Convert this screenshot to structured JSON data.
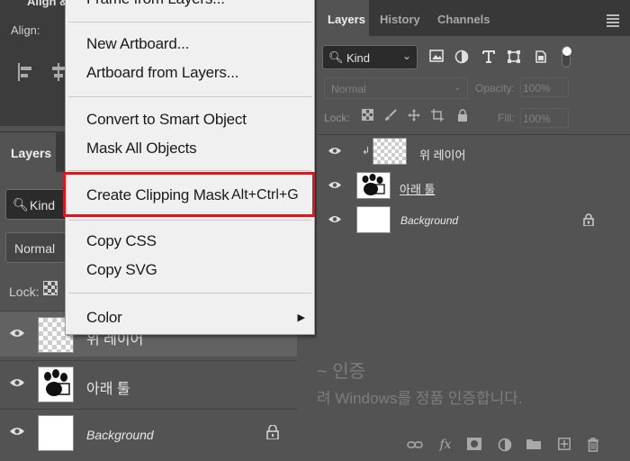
{
  "align_panel": {
    "title": "Align &",
    "align_label": "Align:"
  },
  "layers_left": {
    "tab_label": "Layers",
    "kind_label": "Kind",
    "blend_mode": "Normal",
    "lock_label": "Lock:",
    "layers": [
      {
        "name": "위 레이어",
        "selected": true
      },
      {
        "name": "아래 툴",
        "selected": false
      },
      {
        "name": "Background",
        "selected": false
      }
    ]
  },
  "context_menu": {
    "items": [
      {
        "label": "Frame from Layers...",
        "shortcut": ""
      },
      {
        "label": "New Artboard...",
        "shortcut": ""
      },
      {
        "label": "Artboard from Layers...",
        "shortcut": ""
      },
      {
        "label": "Convert to Smart Object",
        "shortcut": ""
      },
      {
        "label": "Mask All Objects",
        "shortcut": ""
      },
      {
        "label": "Create Clipping Mask",
        "shortcut": "Alt+Ctrl+G"
      },
      {
        "label": "Copy CSS",
        "shortcut": ""
      },
      {
        "label": "Copy SVG",
        "shortcut": ""
      },
      {
        "label": "Color",
        "shortcut": ""
      }
    ],
    "highlight_color": "#e0141a"
  },
  "layers_right": {
    "tabs": [
      "Layers",
      "History",
      "Channels"
    ],
    "kind_label": "Kind",
    "blend_mode": "Normal",
    "opacity_label": "Opacity:",
    "opacity_value": "100%",
    "lock_label": "Lock:",
    "fill_label": "Fill:",
    "fill_value": "100%",
    "layers": [
      {
        "name": "위 레이어",
        "clipped": true
      },
      {
        "name": "아래 툴",
        "clipped": false
      },
      {
        "name": "Background",
        "clipped": false
      }
    ]
  },
  "watermark": {
    "line1": "~ 인증",
    "line2": "려 Windows를 정품 인증합니다."
  },
  "colors": {
    "panel_bg": "#535353",
    "menu_bg": "#f0f0f0",
    "highlight": "#e0141a"
  }
}
